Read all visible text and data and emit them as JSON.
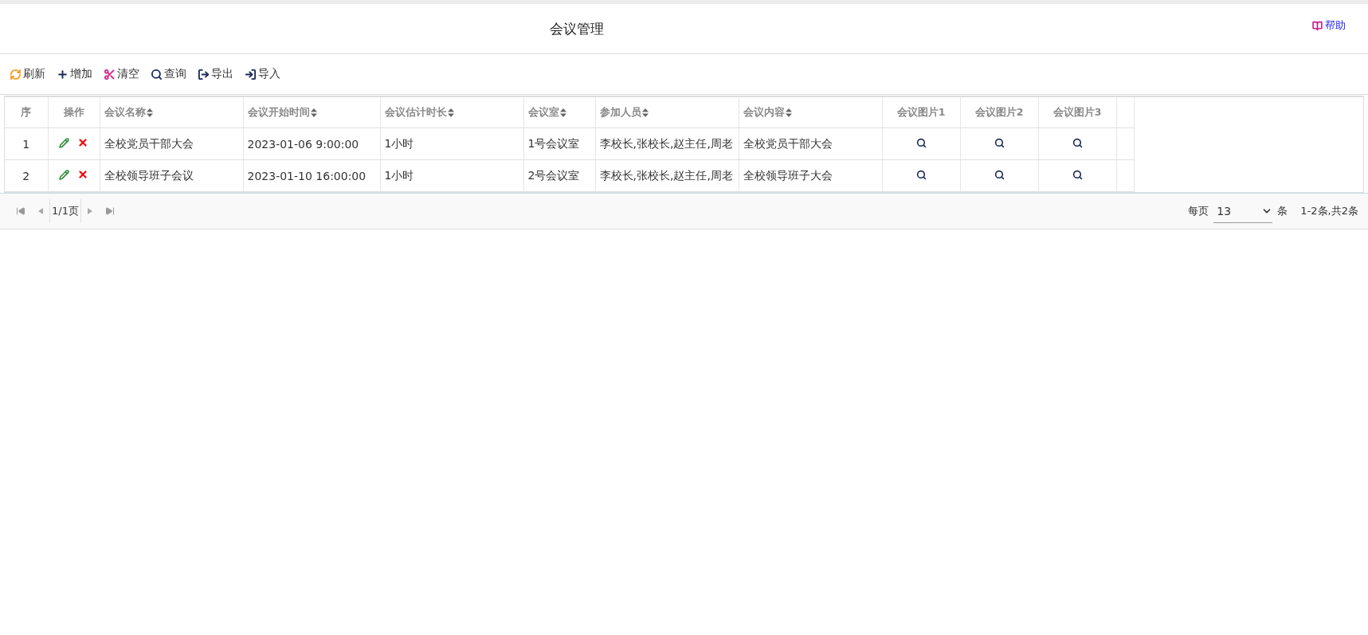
{
  "header": {
    "title": "会议管理",
    "help": "帮助"
  },
  "toolbar": [
    {
      "kind": "refresh",
      "label": "刷新"
    },
    {
      "kind": "add",
      "label": "增加"
    },
    {
      "kind": "clear",
      "label": "清空"
    },
    {
      "kind": "query",
      "label": "查询"
    },
    {
      "kind": "export",
      "label": "导出"
    },
    {
      "kind": "import",
      "label": "导入"
    }
  ],
  "table": {
    "columns": [
      {
        "label": "序",
        "kind": "center",
        "sortable": false
      },
      {
        "label": "操作",
        "kind": "center",
        "sortable": false
      },
      {
        "label": "会议名称",
        "kind": "left",
        "sortable": true
      },
      {
        "label": "会议开始时间",
        "kind": "left",
        "sortable": true
      },
      {
        "label": "会议估计时长",
        "kind": "left",
        "sortable": true
      },
      {
        "label": "会议室",
        "kind": "left",
        "sortable": true
      },
      {
        "label": "参加人员",
        "kind": "left",
        "sortable": true
      },
      {
        "label": "会议内容",
        "kind": "left",
        "sortable": true
      },
      {
        "label": "会议图片1",
        "kind": "center",
        "sortable": false
      },
      {
        "label": "会议图片2",
        "kind": "center",
        "sortable": false
      },
      {
        "label": "会议图片3",
        "kind": "center",
        "sortable": false
      }
    ],
    "rows": [
      {
        "index": "1",
        "name": "全校党员干部大会",
        "start": "2023-01-06 9:00:00",
        "duration": "1小时",
        "room": "1号会议室",
        "people": "李校长,张校长,赵主任,周老",
        "content": "全校党员干部大会"
      },
      {
        "index": "2",
        "name": "全校领导班子会议",
        "start": "2023-01-10 16:00:00",
        "duration": "1小时",
        "room": "2号会议室",
        "people": "李校长,张校长,赵主任,周老",
        "content": "全校领导班子大会"
      }
    ]
  },
  "pager": {
    "page": "1/1页",
    "per_page_label": "每页",
    "per_page": "13",
    "unit": "条",
    "summary": "1-2条,共2条"
  }
}
